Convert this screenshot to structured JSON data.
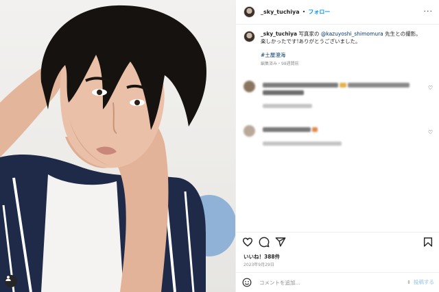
{
  "post": {
    "username": "_sky_tuchiya",
    "separator": "•",
    "follow_label": "フォロー",
    "more_icon": "more-horizontal-icon"
  },
  "caption": {
    "username": "_sky_tuchiya",
    "text_before_mention": " 写真家の ",
    "mention": "@kazuyoshi_shimomura",
    "text_after_mention": " 先生との撮影。",
    "line2": "楽しかったです!ありがとうございました。",
    "hashtag": "#土屋澄海",
    "edited": "編集済み・98週間前"
  },
  "actions": {
    "icons": [
      "heart-icon",
      "comment-icon",
      "share-icon",
      "save-icon"
    ],
    "likes": "いいね！388件",
    "date": "2023年9月29日"
  },
  "comment_box": {
    "placeholder": "コメントを追加...",
    "post_label": "投稿する",
    "emoji_icon": "emoji-icon"
  },
  "colors": {
    "link": "#0095f6",
    "mention": "#00376b",
    "muted": "#8e8e8e"
  }
}
